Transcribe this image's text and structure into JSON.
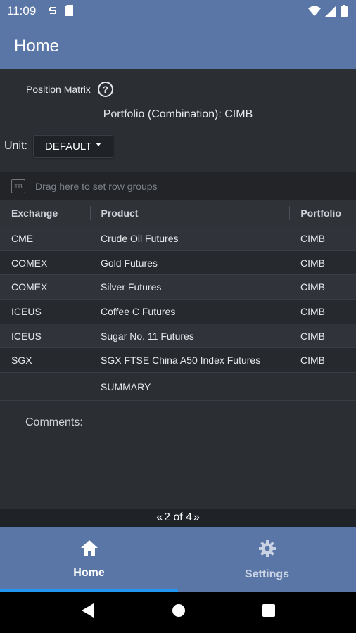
{
  "status_bar": {
    "time": "11:09",
    "left_icons": [
      "sync-icon",
      "sd-card-icon"
    ],
    "right_icons": [
      "wifi-icon",
      "signal-icon",
      "battery-icon"
    ]
  },
  "app_bar": {
    "title": "Home"
  },
  "content": {
    "position_matrix_label": "Position Matrix",
    "help_icon_glyph": "?",
    "portfolio_title": "Portfolio (Combination): CIMB",
    "unit_label": "Unit:",
    "unit_value": "DEFAULT"
  },
  "grid": {
    "group_panel_icon": "TB",
    "group_panel_text": "Drag here to set row groups",
    "columns": [
      "Exchange",
      "Product",
      "Portfolio"
    ],
    "rows": [
      {
        "exchange": "CME",
        "product": "Crude Oil Futures",
        "portfolio": "CIMB"
      },
      {
        "exchange": "COMEX",
        "product": "Gold Futures",
        "portfolio": "CIMB"
      },
      {
        "exchange": "COMEX",
        "product": "Silver Futures",
        "portfolio": "CIMB"
      },
      {
        "exchange": "ICEUS",
        "product": "Coffee C Futures",
        "portfolio": "CIMB"
      },
      {
        "exchange": "ICEUS",
        "product": "Sugar No. 11 Futures",
        "portfolio": "CIMB"
      },
      {
        "exchange": "SGX",
        "product": "SGX FTSE China A50 Index Futures",
        "portfolio": "CIMB"
      }
    ],
    "summary_label": "SUMMARY"
  },
  "comments_label": "Comments:",
  "pager": {
    "prev_glyph": "«",
    "text": "2 of 4",
    "next_glyph": "»"
  },
  "bottom_nav": {
    "items": [
      {
        "label": "Home",
        "icon": "home-icon",
        "active": true
      },
      {
        "label": "Settings",
        "icon": "gear-icon",
        "active": false
      }
    ]
  },
  "colors": {
    "app_bar": "#5a76a6",
    "background": "#2b2e33",
    "active_indicator": "#2196f3"
  }
}
